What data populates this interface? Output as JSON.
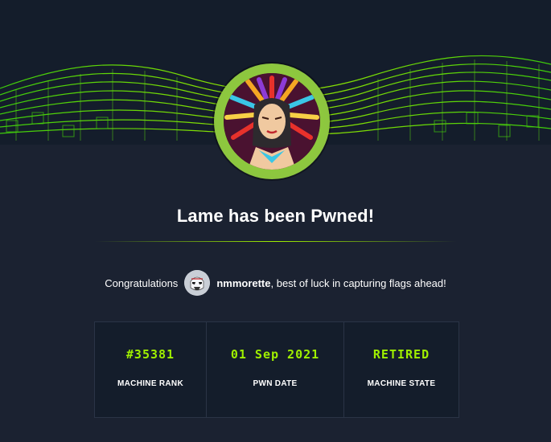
{
  "header": {
    "background_color": "#141d2b",
    "accent_color": "#9fef00"
  },
  "machine": {
    "avatar_icon": "machine-avatar-icon",
    "title": "Lame has been Pwned!"
  },
  "congrats": {
    "prefix": "Congratulations",
    "username": "nmmorette",
    "suffix": ", best of luck in capturing flags ahead!",
    "user_avatar_icon": "stormtrooper-avatar-icon"
  },
  "stats": [
    {
      "value": "#35381",
      "label": "MACHINE RANK"
    },
    {
      "value": "01 Sep 2021",
      "label": "PWN DATE"
    },
    {
      "value": "RETIRED",
      "label": "MACHINE STATE"
    }
  ]
}
